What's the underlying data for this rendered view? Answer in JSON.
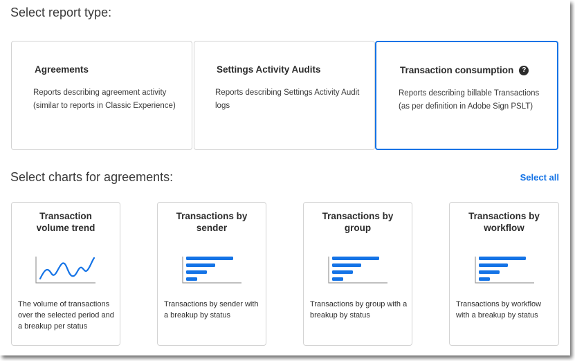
{
  "report_section": {
    "title": "Select report type:",
    "cards": [
      {
        "title": "Agreements",
        "desc": "Reports describing agreement activity\n(similar to reports in Classic Experience)",
        "selected": false
      },
      {
        "title": "Settings Activity Audits",
        "desc": "Reports describing Settings Activity Audit\nlogs",
        "selected": false
      },
      {
        "title": "Transaction consumption",
        "desc": "Reports describing billable Transactions\n(as per definition in Adobe Sign PSLT)",
        "selected": true,
        "help_icon": "help-icon",
        "help_glyph": "?"
      }
    ]
  },
  "charts_section": {
    "title": "Select charts for agreements:",
    "select_all": "Select all",
    "cards": [
      {
        "title": "Transaction\nvolume trend",
        "desc": "The volume of transactions\nover the selected period and\na breakup per status",
        "icon": "line-chart-icon"
      },
      {
        "title": "Transactions by\nsender",
        "desc": "Transactions by sender with\na breakup by status",
        "icon": "bar-chart-icon"
      },
      {
        "title": "Transactions by\ngroup",
        "desc": "Transactions by group with a\nbreakup by status",
        "icon": "bar-chart-icon"
      },
      {
        "title": "Transactions by\nworkflow",
        "desc": "Transactions by workflow\nwith a breakup by status",
        "icon": "bar-chart-icon"
      }
    ]
  },
  "colors": {
    "accent": "#1473e6",
    "icon_axis": "#9a9a9a",
    "border": "#d3d3d3"
  }
}
